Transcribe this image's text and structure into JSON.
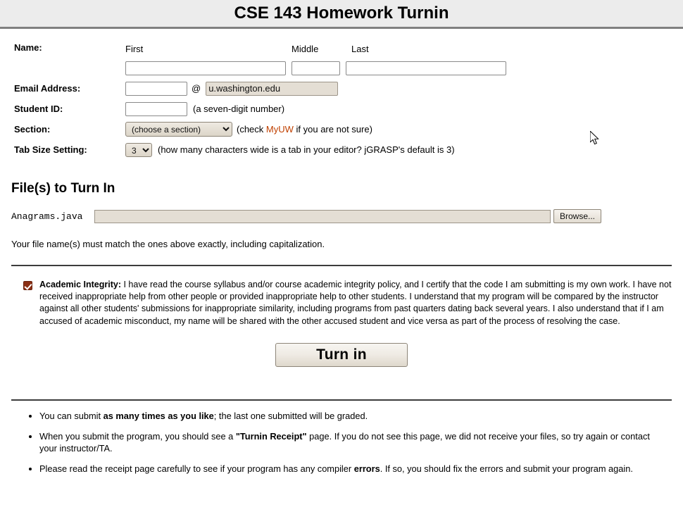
{
  "header": {
    "title": "CSE 143 Homework Turnin"
  },
  "form": {
    "name": {
      "label": "Name:",
      "col_first": "First",
      "col_middle": "Middle",
      "col_last": "Last",
      "first_value": "",
      "middle_value": "",
      "last_value": ""
    },
    "email": {
      "label": "Email Address:",
      "local_value": "",
      "at": "@",
      "domain_value": "u.washington.edu"
    },
    "student_id": {
      "label": "Student ID:",
      "value": "",
      "hint": "(a seven-digit number)"
    },
    "section": {
      "label": "Section:",
      "selected": "(choose a section)",
      "options": [
        "(choose a section)"
      ],
      "hint_before": "(check ",
      "link_text": "MyUW",
      "hint_after": " if you are not sure)"
    },
    "tab_size": {
      "label": "Tab Size Setting:",
      "selected": "3",
      "options": [
        "3"
      ],
      "hint": "(how many characters wide is a tab in your editor? jGRASP's default is 3)"
    }
  },
  "files": {
    "section_title": "File(s) to Turn In",
    "file_label": "Anagrams.java",
    "file_input_value": "",
    "browse_label": "Browse...",
    "note": "Your file name(s) must match the ones above exactly, including capitalization."
  },
  "integrity": {
    "checked": true,
    "heading": "Academic Integrity:",
    "body": " I have read the course syllabus and/or course academic integrity policy, and I certify that the code I am submitting is my own work. I have not received inappropriate help from other people or provided inappropriate help to other students. I understand that my program will be compared by the instructor against all other students' submissions for inappropriate similarity, including programs from past quarters dating back several years. I also understand that if I am accused of academic misconduct, my name will be shared with the other accused student and vice versa as part of the process of resolving the case."
  },
  "submit": {
    "label": "Turn in"
  },
  "notes": [
    {
      "pre": "You can submit ",
      "bold": "as many times as you like",
      "post": "; the last one submitted will be graded."
    },
    {
      "pre": "When you submit the program, you should see a ",
      "bold": "\"Turnin Receipt\"",
      "post": " page. If you do not see this page, we did not receive your files, so try again or contact your instructor/TA."
    },
    {
      "pre": "Please read the receipt page carefully to see if your program has any compiler ",
      "bold": "errors",
      "post": ". If so, you should fix the errors and submit your program again."
    }
  ],
  "colors": {
    "header_bg": "#ececec",
    "header_border": "#808080",
    "link": "#c04000",
    "checkbox": "#8b2f14",
    "readonly_field": "#e4ded4",
    "divider": "#3c3c3c"
  }
}
